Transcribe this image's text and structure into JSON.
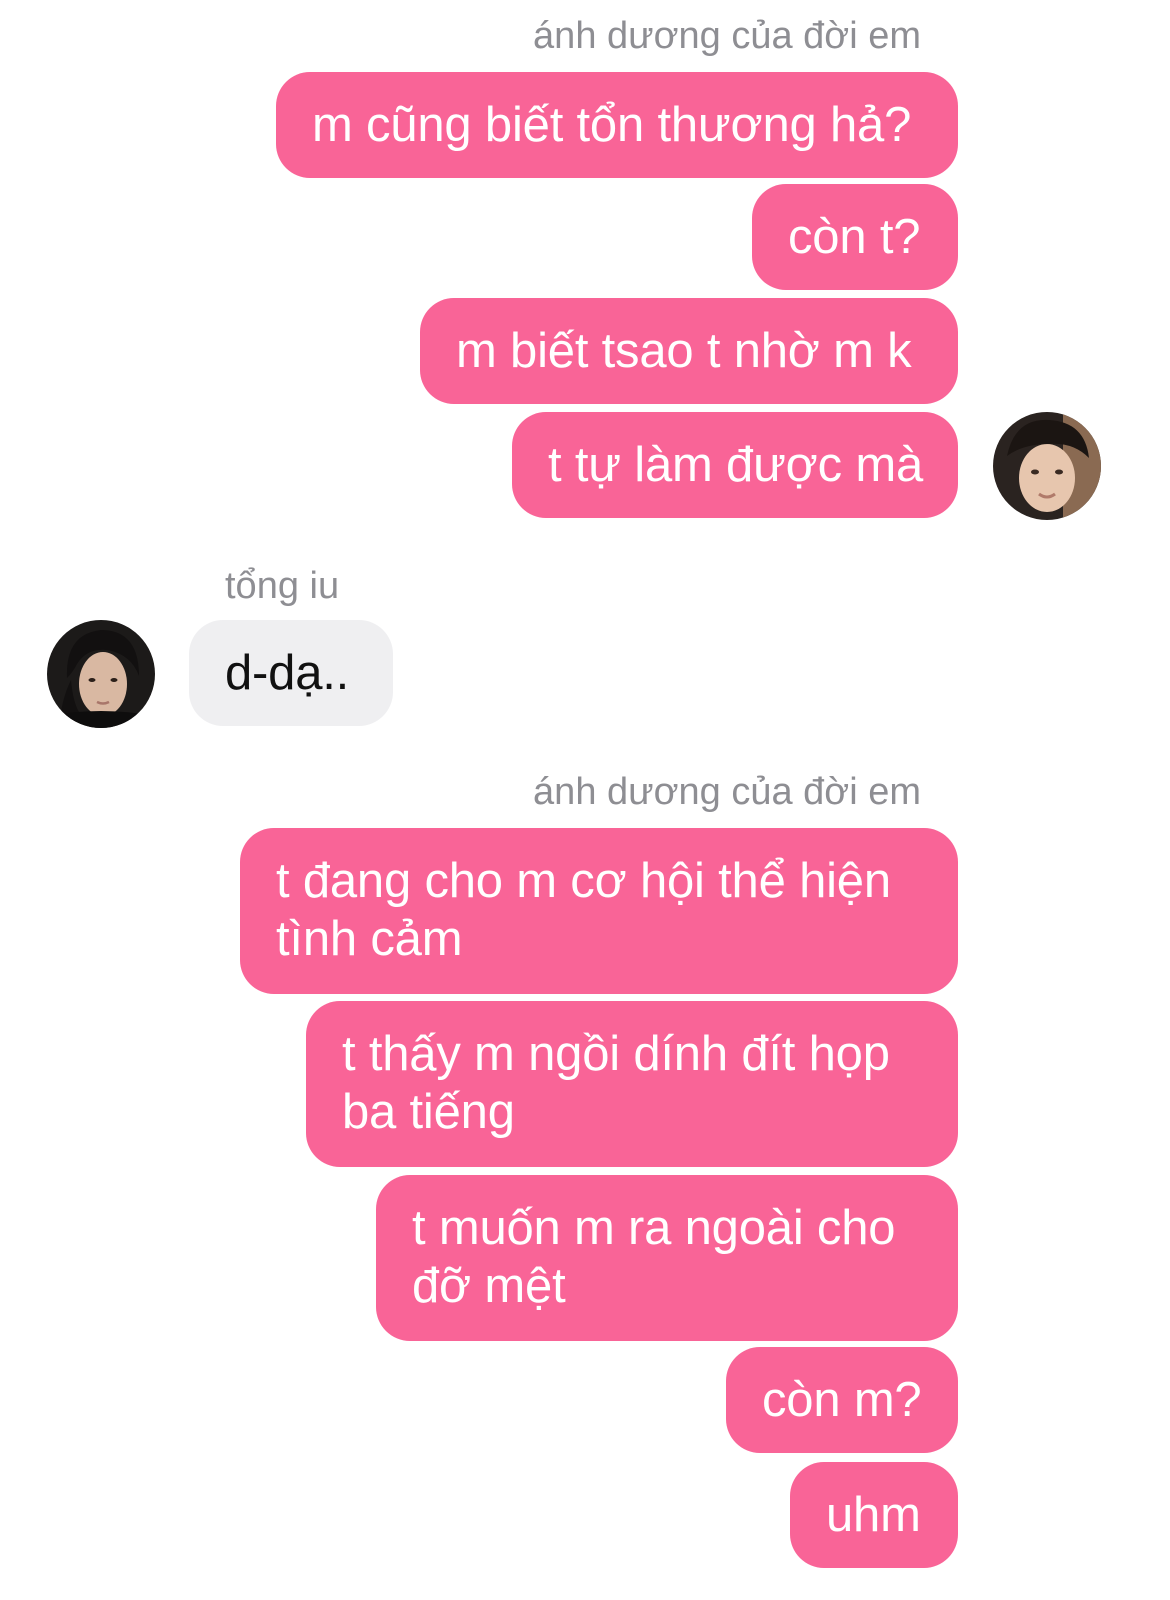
{
  "thread": {
    "group1": {
      "sender_name": "ánh dương của đời em",
      "messages": [
        "m cũng biết tổn thương hả?",
        "còn t?",
        "m biết tsao t nhờ m k",
        "t tự làm được mà"
      ]
    },
    "group2": {
      "sender_name": "tổng iu",
      "messages": [
        "d-dạ.."
      ]
    },
    "group3": {
      "sender_name": "ánh dương của đời em",
      "messages": [
        "t đang cho m cơ hội thể hiện tình cảm",
        "t thấy m ngồi dính đít họp ba tiếng",
        "t muốn m ra ngoài cho đỡ mệt",
        "còn m?",
        "uhm"
      ]
    }
  },
  "colors": {
    "outgoing_bubble": "#f96497",
    "incoming_bubble": "#efeff1",
    "sender_name": "#8e8e93"
  }
}
